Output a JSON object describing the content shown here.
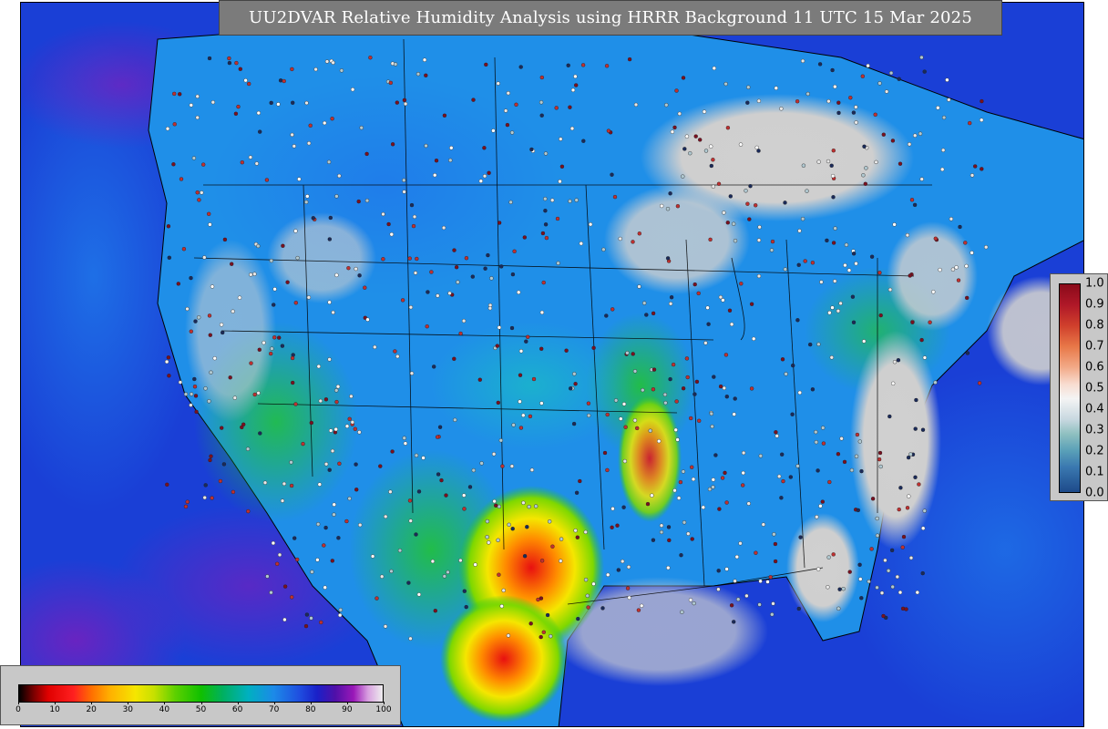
{
  "title": "UU2DVAR Relative Humidity Analysis using HRRR Background 11 UTC 15 Mar 2025",
  "rh_colorbar": {
    "ticks": [
      "0",
      "10",
      "20",
      "30",
      "40",
      "50",
      "60",
      "70",
      "80",
      "90",
      "100"
    ],
    "range": [
      0,
      100
    ]
  },
  "increment_colorbar": {
    "ticks": [
      "1.0",
      "0.9",
      "0.8",
      "0.7",
      "0.6",
      "0.5",
      "0.4",
      "0.3",
      "0.2",
      "0.1",
      "0.0"
    ],
    "range": [
      0.0,
      1.0
    ]
  },
  "colors": {
    "ocean_deep": "#1a3fd6",
    "ocean_cyan": "#1aa0e0",
    "dry_red": "#e21010",
    "moist_green": "#22c822",
    "saturated_gray": "#c8c8c8",
    "purple": "#7a10a8",
    "panel_gray": "#7b7b7b"
  }
}
